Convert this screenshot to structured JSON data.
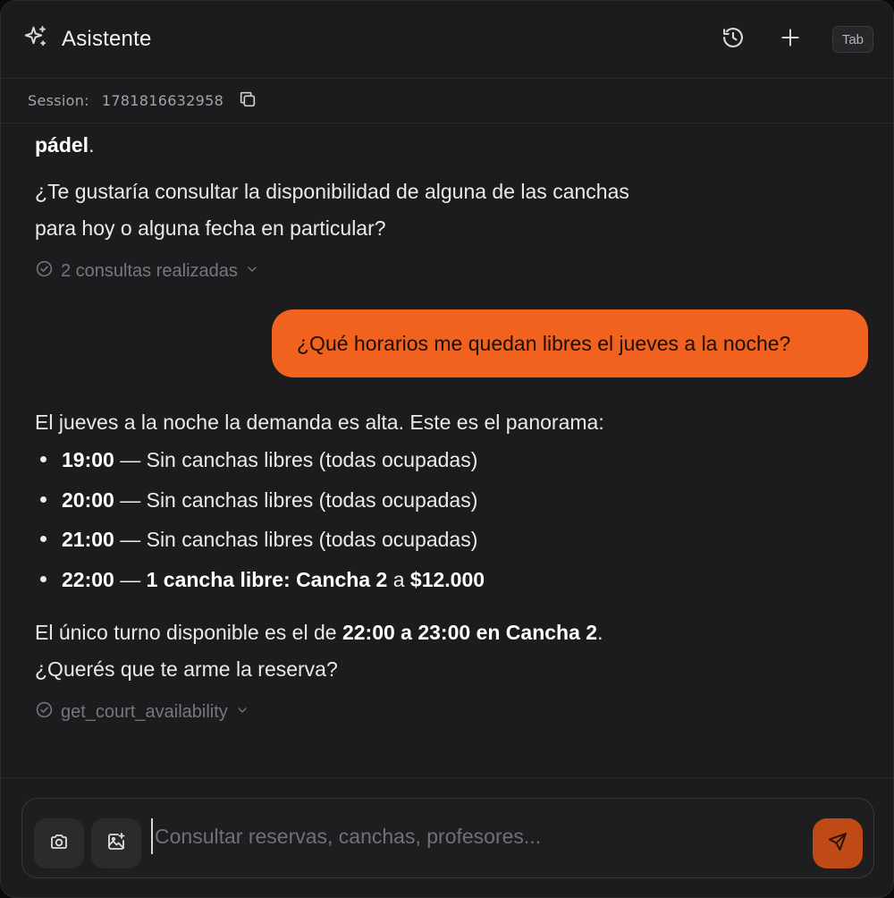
{
  "header": {
    "title": "Asistente",
    "tab_badge": "Tab"
  },
  "session": {
    "label": "Session:",
    "id": "1781816632958"
  },
  "messages": {
    "assistant_1": {
      "partial_line": "pádel",
      "partial_punct": ".",
      "question_line1": "¿Te gustaría consultar la disponibilidad de alguna de las canchas",
      "question_line2": "para hoy o alguna fecha en particular?",
      "tool_chip": "2 consultas realizadas"
    },
    "user_1": {
      "text": "¿Qué horarios me quedan libres el jueves a la noche?"
    },
    "assistant_2": {
      "intro": "El jueves a la noche la demanda es alta. Este es el panorama:",
      "slots": [
        {
          "time": "19:00",
          "sep": " — ",
          "desc": "Sin canchas libres (todas ocupadas)"
        },
        {
          "time": "20:00",
          "sep": " — ",
          "desc": "Sin canchas libres (todas ocupadas)"
        },
        {
          "time": "21:00",
          "sep": " — ",
          "desc": "Sin canchas libres (todas ocupadas)"
        },
        {
          "time": "22:00",
          "sep": " — ",
          "desc_bold": "1 cancha libre: Cancha 2",
          "desc_mid": " a ",
          "price": "$12.000"
        }
      ],
      "summary_prefix": "El único turno disponible es el de ",
      "summary_bold": "22:00 a 23:00 en Cancha 2",
      "summary_suffix": ".",
      "followup": "¿Querés que te arme la reserva?",
      "tool_chip": "get_court_availability"
    }
  },
  "composer": {
    "placeholder": "Consultar reservas, canchas, profesores...",
    "value": ""
  },
  "colors": {
    "accent": "#f2621f",
    "send_button": "#bf4a15",
    "background": "#1c1c1e"
  },
  "icons": {
    "title": "sparkles-icon",
    "history": "history-icon",
    "new": "plus-icon",
    "copy": "copy-icon",
    "tool_status": "check-circle-icon",
    "expand": "chevron-down-icon",
    "camera": "camera-icon",
    "image": "image-plus-icon",
    "send": "send-icon"
  }
}
